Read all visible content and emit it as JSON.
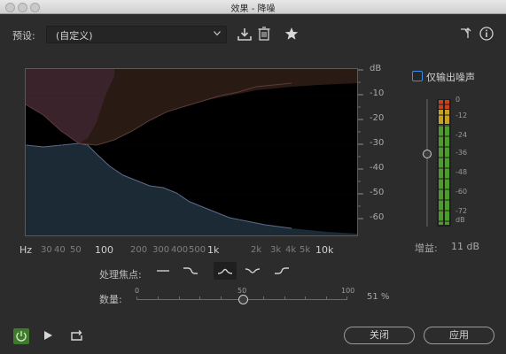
{
  "window": {
    "title": "效果 - 降噪"
  },
  "preset": {
    "label": "预设:",
    "value": "(自定义)"
  },
  "graph": {
    "db_ticks": [
      "dB",
      "-10",
      "-20",
      "-30",
      "-40",
      "-50",
      "-60"
    ],
    "freq_ticks_minor": [
      "Hz",
      "30",
      "40",
      "50",
      "200",
      "300",
      "400",
      "500",
      "2k",
      "3k",
      "4k",
      "5k"
    ],
    "freq_ticks_major": [
      "100",
      "1k",
      "10k"
    ]
  },
  "output_noise": {
    "label": "仅输出噪声",
    "checked": false
  },
  "meter": {
    "scale": [
      "0",
      "-12",
      "-24",
      "-36",
      "-48",
      "-60",
      "-72",
      "dB"
    ],
    "gain_label": "增益:",
    "gain_value": "11 dB"
  },
  "processing_focus": {
    "label": "处理焦点:",
    "options": [
      "flat-focus",
      "low-focus",
      "mid-focus",
      "high-mid-focus",
      "high-focus"
    ],
    "selected_index": 2
  },
  "amount": {
    "label": "数量:",
    "min": "0",
    "mid": "50",
    "max": "100",
    "value": "51 %",
    "level": 51
  },
  "footer": {
    "close_label": "关闭",
    "apply_label": "应用"
  },
  "colors": {
    "background": "#2c2c2c",
    "noise_fill": "#2a1a14",
    "signal_fill": "#1c2a36",
    "accent_blue": "#3a8ee6",
    "power_green": "#3f7a2c"
  }
}
